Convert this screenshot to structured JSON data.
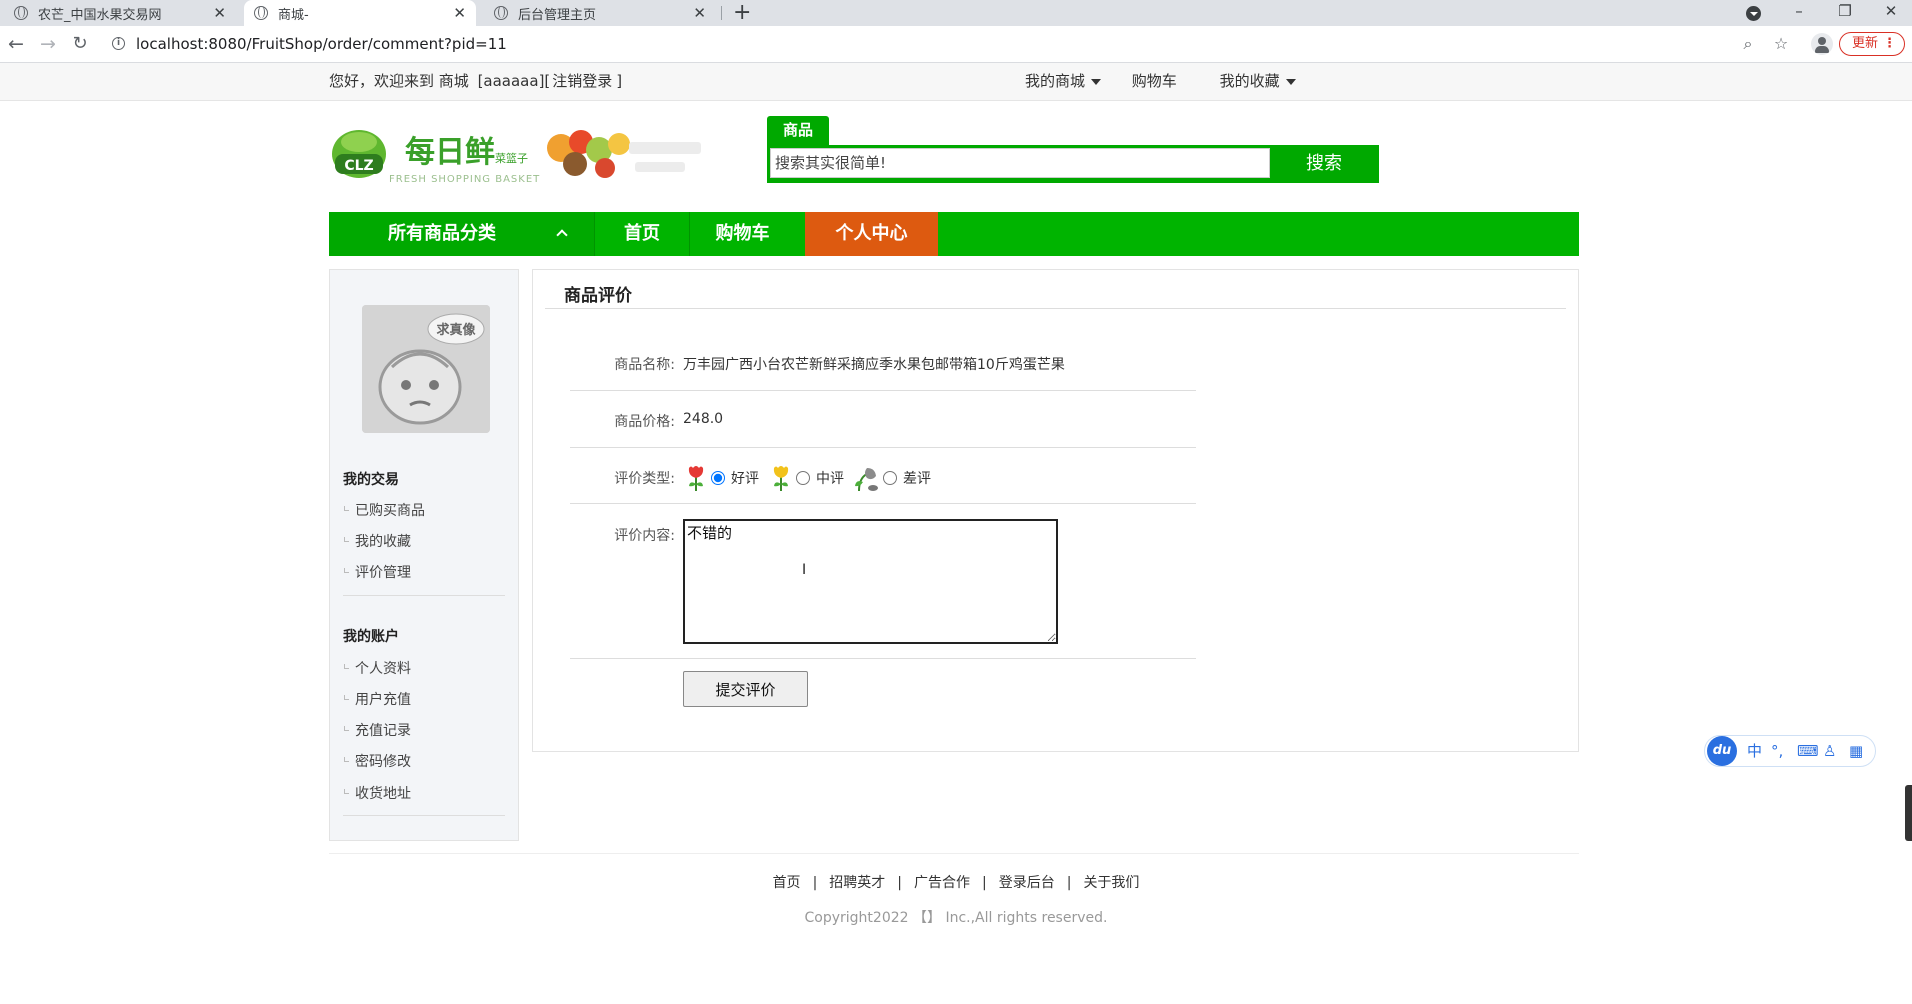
{
  "browser": {
    "tabs": [
      {
        "title": "农芒_中国水果交易网"
      },
      {
        "title": "商城-"
      },
      {
        "title": "后台管理主页"
      }
    ],
    "new_tab": "+",
    "url": "localhost:8080/FruitShop/order/comment?pid=11",
    "update_label": "更新"
  },
  "topbar": {
    "greeting": "您好，欢迎来到 商城",
    "username": "[aaaaaa][",
    "logout": "注销登录",
    "close_bracket": "]",
    "my_mall": "我的商城",
    "cart": "购物车",
    "favorites": "我的收藏"
  },
  "logo": {
    "badge": "CLZ",
    "name": "每日鲜",
    "sub": "菜篮子",
    "slogan": "FRESH SHOPPING BASKET"
  },
  "search": {
    "tab": "商品",
    "placeholder": "搜索其实很简单!",
    "button": "搜索"
  },
  "nav": {
    "category": "所有商品分类",
    "items": [
      "首页",
      "购物车",
      "个人中心"
    ]
  },
  "sidebar": {
    "avatar_text": "求真像",
    "section1": "我的交易",
    "section1_links": [
      "已购买商品",
      "我的收藏",
      "评价管理"
    ],
    "section2": "我的账户",
    "section2_links": [
      "个人资料",
      "用户充值",
      "充值记录",
      "密码修改",
      "收货地址"
    ]
  },
  "review": {
    "title": "商品评价",
    "name_label": "商品名称:",
    "name_value": "万丰园广西小台农芒新鲜采摘应季水果包邮带箱10斤鸡蛋芒果",
    "price_label": "商品价格:",
    "price_value": "248.0",
    "type_label": "评价类型:",
    "types": [
      "好评",
      "中评",
      "差评"
    ],
    "selected_type": "好评",
    "content_label": "评价内容:",
    "content_value": "不错的",
    "submit": "提交评价"
  },
  "footer": {
    "links": [
      "首页",
      "招聘英才",
      "广告合作",
      "登录后台",
      "关于我们"
    ],
    "separator": "|",
    "copyright": "Copyright2022 【】 Inc.,All rights reserved."
  },
  "ime": {
    "logo": "du",
    "mode": "中"
  },
  "colors": {
    "brand_green": "#00a900",
    "nav_green": "#00b400",
    "active_orange": "#dd5a10"
  }
}
